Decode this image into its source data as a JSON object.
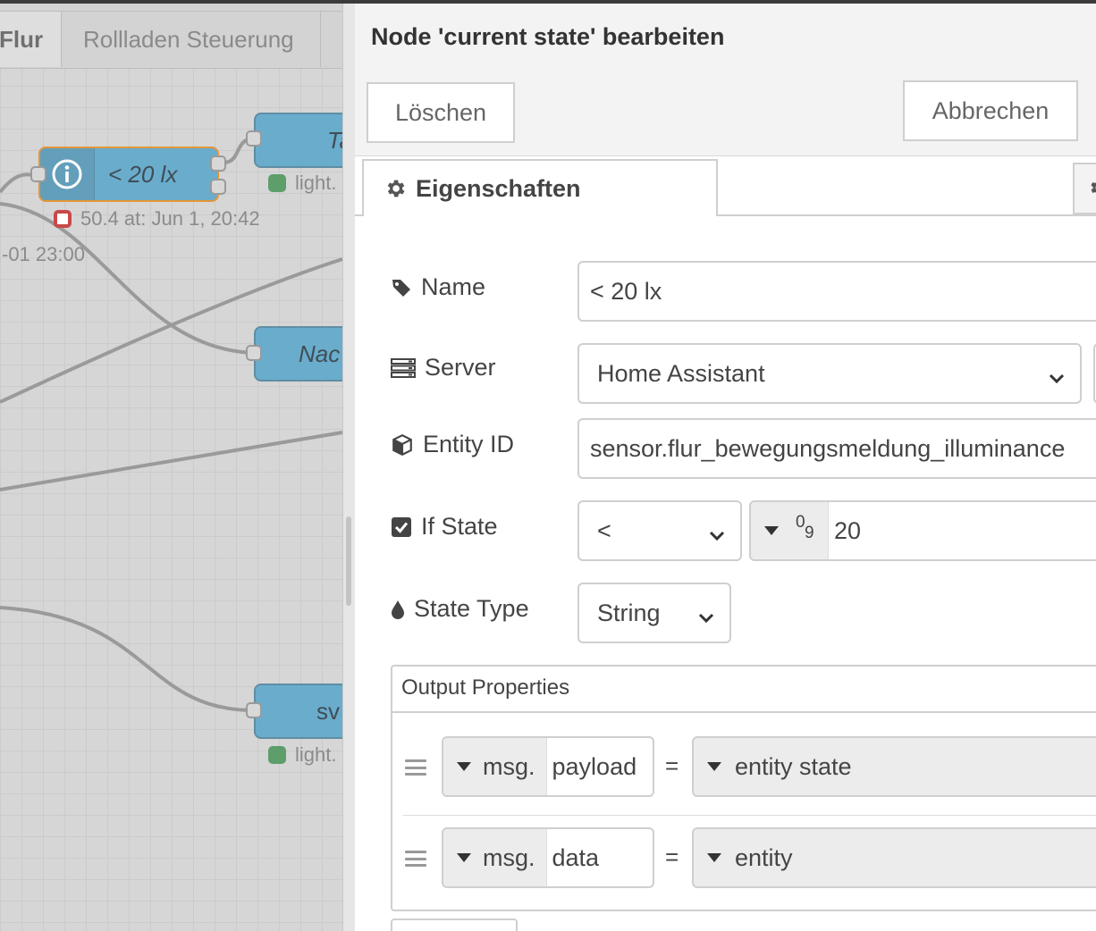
{
  "workspace": {
    "tabs": [
      {
        "label": "Flur",
        "active": true
      },
      {
        "label": "Rollladen Steuerung",
        "active": false
      }
    ],
    "nodes": {
      "selected_node": {
        "label": "< 20 lx",
        "icon": "info-icon"
      },
      "top_right_node": {
        "label": "Ta",
        "status": "light."
      },
      "middle_node": {
        "label": "Nac"
      },
      "bottom_node": {
        "label": "sv",
        "status": "light."
      }
    },
    "selected_status": "50.4 at: Jun 1, 20:42",
    "timestamp_fragment": "-01 23:00",
    "colors": {
      "node": "#6aaccc",
      "selected_border": "#e3963b",
      "status_red": "#c9494a",
      "status_green": "#5d9e6a"
    }
  },
  "editor": {
    "title": "Node 'current state' bearbeiten",
    "delete_label": "Löschen",
    "cancel_label": "Abbrechen",
    "tab_label": "Eigenschaften",
    "fields": {
      "name": {
        "label": "Name",
        "value": "< 20 lx",
        "icon": "tag-icon"
      },
      "server": {
        "label": "Server",
        "value": "Home Assistant",
        "icon": "server-icon"
      },
      "entity": {
        "label": "Entity ID",
        "value": "sensor.flur_bewegungsmeldung_illuminance",
        "icon": "cube-icon"
      },
      "if_state": {
        "label": "If State",
        "operator": "<",
        "type_marker_top": "0",
        "type_marker_bottom": "9",
        "value": "20",
        "icon": "checkbox-icon"
      },
      "state_type": {
        "label": "State Type",
        "value": "String",
        "icon": "drop-icon"
      }
    },
    "output": {
      "title": "Output Properties",
      "rows": [
        {
          "prefix": "msg.",
          "property": "payload",
          "eq": "=",
          "value": "entity state"
        },
        {
          "prefix": "msg.",
          "property": "data",
          "eq": "=",
          "value": "entity"
        }
      ]
    }
  }
}
